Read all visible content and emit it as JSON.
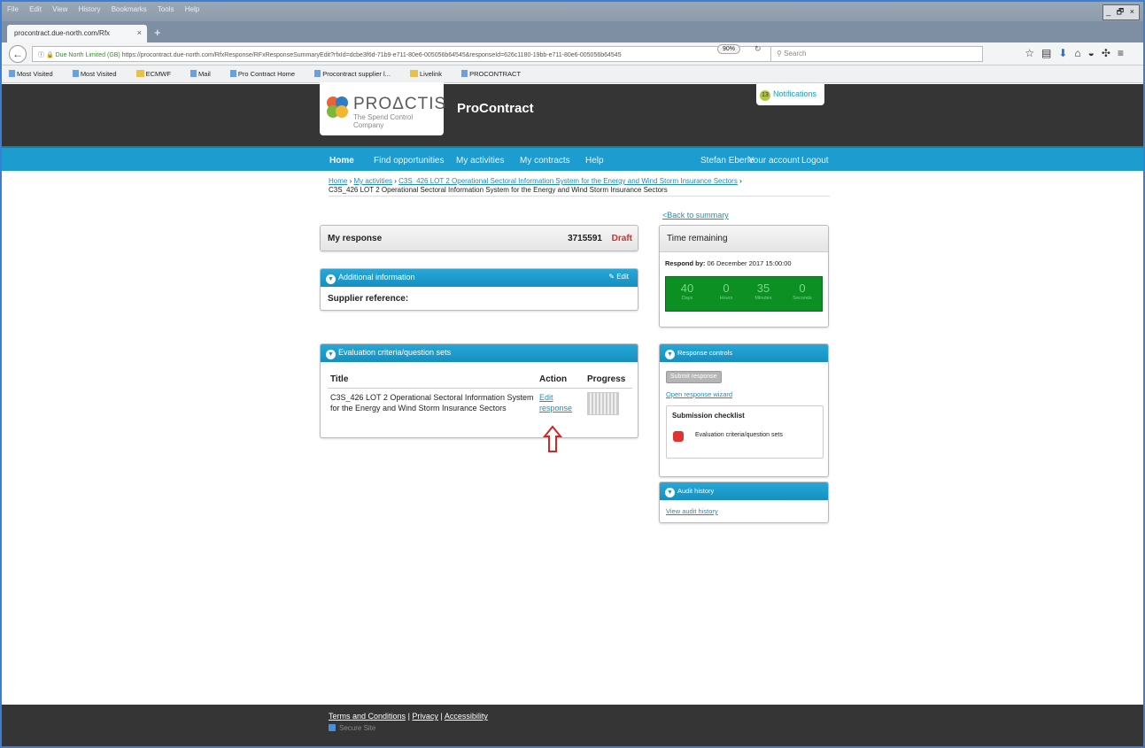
{
  "browser": {
    "menu": [
      "File",
      "Edit",
      "View",
      "History",
      "Bookmarks",
      "Tools",
      "Help"
    ],
    "window_controls": "_ 🗗 ×",
    "tab_title": "procontract.due-north.com/Rfx",
    "tab_close": "×",
    "new_tab": "+",
    "url_identity": "Due North Limited (GB)",
    "url": "https://procontract.due-north.com/RfxResponse/RFxResponseSummaryEdit?rfxId=dcbe3f6d-71b9-e711-80e6-005056b64545&responseId=626c1180-19bb-e711-80e6-005056b64545",
    "zoom": "90%",
    "search_placeholder": "Search",
    "bookmarks": [
      "Most Visited",
      "Most Visited",
      "ECMWF",
      "Mail",
      "Pro Contract Home",
      "Procontract supplier l...",
      "Livelink",
      "PROCONTRACT"
    ]
  },
  "header": {
    "logo_text": "PROΔCTIS",
    "logo_tagline": "The Spend Control Company",
    "site_name": "ProContract",
    "notifications_count": "13",
    "notifications_label": "Notifications"
  },
  "nav": {
    "home": "Home",
    "find": "Find opportunities",
    "activities": "My activities",
    "contracts": "My contracts",
    "help": "Help",
    "user": "Stefan Eberle",
    "account": "Your account",
    "logout": "Logout"
  },
  "breadcrumb": {
    "home": "Home",
    "activities": "My activities",
    "project": "C3S_426 LOT 2 Operational Sectoral Information System for the Energy and Wind Storm Insurance Sectors",
    "separator": " › ",
    "current": "C3S_426 LOT 2 Operational Sectoral Information System for the Energy and Wind Storm Insurance Sectors"
  },
  "back_to_summary": "<Back to summary",
  "my_response": {
    "label": "My response",
    "number": "3715591",
    "status": "Draft"
  },
  "additional_info": {
    "title": "Additional information",
    "edit": "Edit",
    "supplier_reference_label": "Supplier reference:"
  },
  "evaluation": {
    "title": "Evaluation criteria/question sets",
    "columns": [
      "Title",
      "Action",
      "Progress"
    ],
    "rows": [
      {
        "title": "C3S_426 LOT 2 Operational Sectoral Information System for the Energy and Wind Storm Insurance Sectors",
        "action": "Edit response",
        "progress": 0
      }
    ]
  },
  "time_remaining": {
    "title": "Time remaining",
    "respond_by_label": "Respond by:",
    "respond_by_value": "06 December 2017 15:00:00",
    "days": "40",
    "days_label": "Days",
    "hours": "0",
    "hours_label": "Hours",
    "minutes": "35",
    "minutes_label": "Minutes",
    "seconds": "0",
    "seconds_label": "Seconds"
  },
  "response_controls": {
    "title": "Response controls",
    "submit": "Submit response",
    "wizard": "Open response wizard",
    "checklist_title": "Submission checklist",
    "checklist_item": "Evaluation criteria/question sets"
  },
  "audit_history": {
    "title": "Audit history",
    "link": "View audit history"
  },
  "footer": {
    "terms": "Terms and Conditions",
    "privacy": "Privacy",
    "accessibility": "Accessibility",
    "separator": "|",
    "secure": "Secure Site"
  },
  "colors": {
    "accent_blue": "#1c9ccf",
    "dark_header": "#353535",
    "draft_red": "#d0302a",
    "countdown_green": "#0c8f23",
    "checklist_red": "#e23333"
  }
}
